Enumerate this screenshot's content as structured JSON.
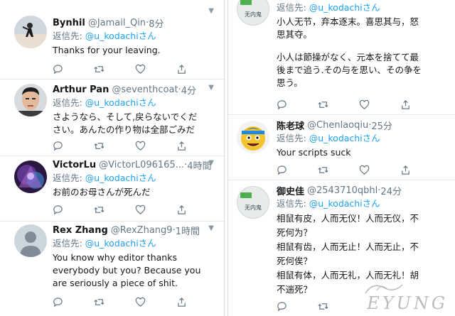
{
  "left_column": {
    "tweets": [
      {
        "display_name": "Bynhil",
        "handle": "@Jamail_Qin",
        "time": "8分",
        "reply_prefix": "返信先:",
        "reply_to": "@u_kodachiさん",
        "lines": [
          "Thanks for your leaving."
        ],
        "avatar": "avatar-beach-person"
      },
      {
        "display_name": "Arthur Pan",
        "handle": "@seventhcoat",
        "time": "4分",
        "reply_prefix": "返信先:",
        "reply_to": "@u_kodachiさん",
        "lines": [
          "さようなら、そして,戻らないでくだ",
          "さい。あんたの作り物は全部ごみだ"
        ],
        "avatar": "avatar-man-portrait"
      },
      {
        "display_name": "VictorLu",
        "handle": "@VictorL096165...",
        "time": "4時間",
        "reply_prefix": "返信先:",
        "reply_to": "@u_kodachiさん",
        "lines": [
          "お前のお母さんが死んだ"
        ],
        "avatar": "avatar-purple-art"
      },
      {
        "display_name": "Rex Zhang",
        "handle": "@RexZhang9",
        "time": "1時間",
        "reply_prefix": "返信先:",
        "reply_to": "@u_kodachiさん",
        "lines": [
          "You know why editor thanks",
          "everybody but you? Because you",
          "are seriously a piece of shit."
        ],
        "avatar": "avatar-default"
      }
    ]
  },
  "right_column": {
    "top_badge": "无内鬼",
    "top_reply_prefix": "返信先:",
    "top_reply_to": "@u_kodachiさん",
    "top_lines": [
      "小人无节，弃本逐末。喜思其与，怒",
      "思其夺。"
    ],
    "top_lines_jp": [
      "小人は節操がなく、元本を捨てて最",
      "後まで追う.その与を思い、その争を",
      "思う。"
    ],
    "tweets": [
      {
        "display_name": "陈老球",
        "handle": "@Chenlaoqiu",
        "time": "25分",
        "reply_prefix": "返信先:",
        "reply_to": "@u_kodachiさん",
        "lines": [
          "Your scripts suck"
        ],
        "avatar": "avatar-cartoon-face"
      },
      {
        "display_name": "御史佳",
        "handle": "@2543710qbhl",
        "time": "24分",
        "reply_prefix": "返信先:",
        "reply_to": "@u_kodachiさん",
        "badge": "无内鬼",
        "lines": [
          "相鼠有皮，人而无仪！人而无仪，不",
          "死何为？",
          "相鼠有齿，人而无止！人而无止，不",
          "死何俟？",
          "相鼠有体，人而无礼，人而无礼！胡",
          "不遄死？"
        ],
        "avatar": "avatar-badge"
      }
    ]
  },
  "watermark": "EYUNG",
  "icons": [
    "reply-icon",
    "retweet-icon",
    "like-icon",
    "share-icon",
    "caret-down-icon"
  ],
  "colors": {
    "link": "#1da1f2",
    "muted": "#657786",
    "text": "#14171a",
    "divider": "#e1e8ed"
  }
}
